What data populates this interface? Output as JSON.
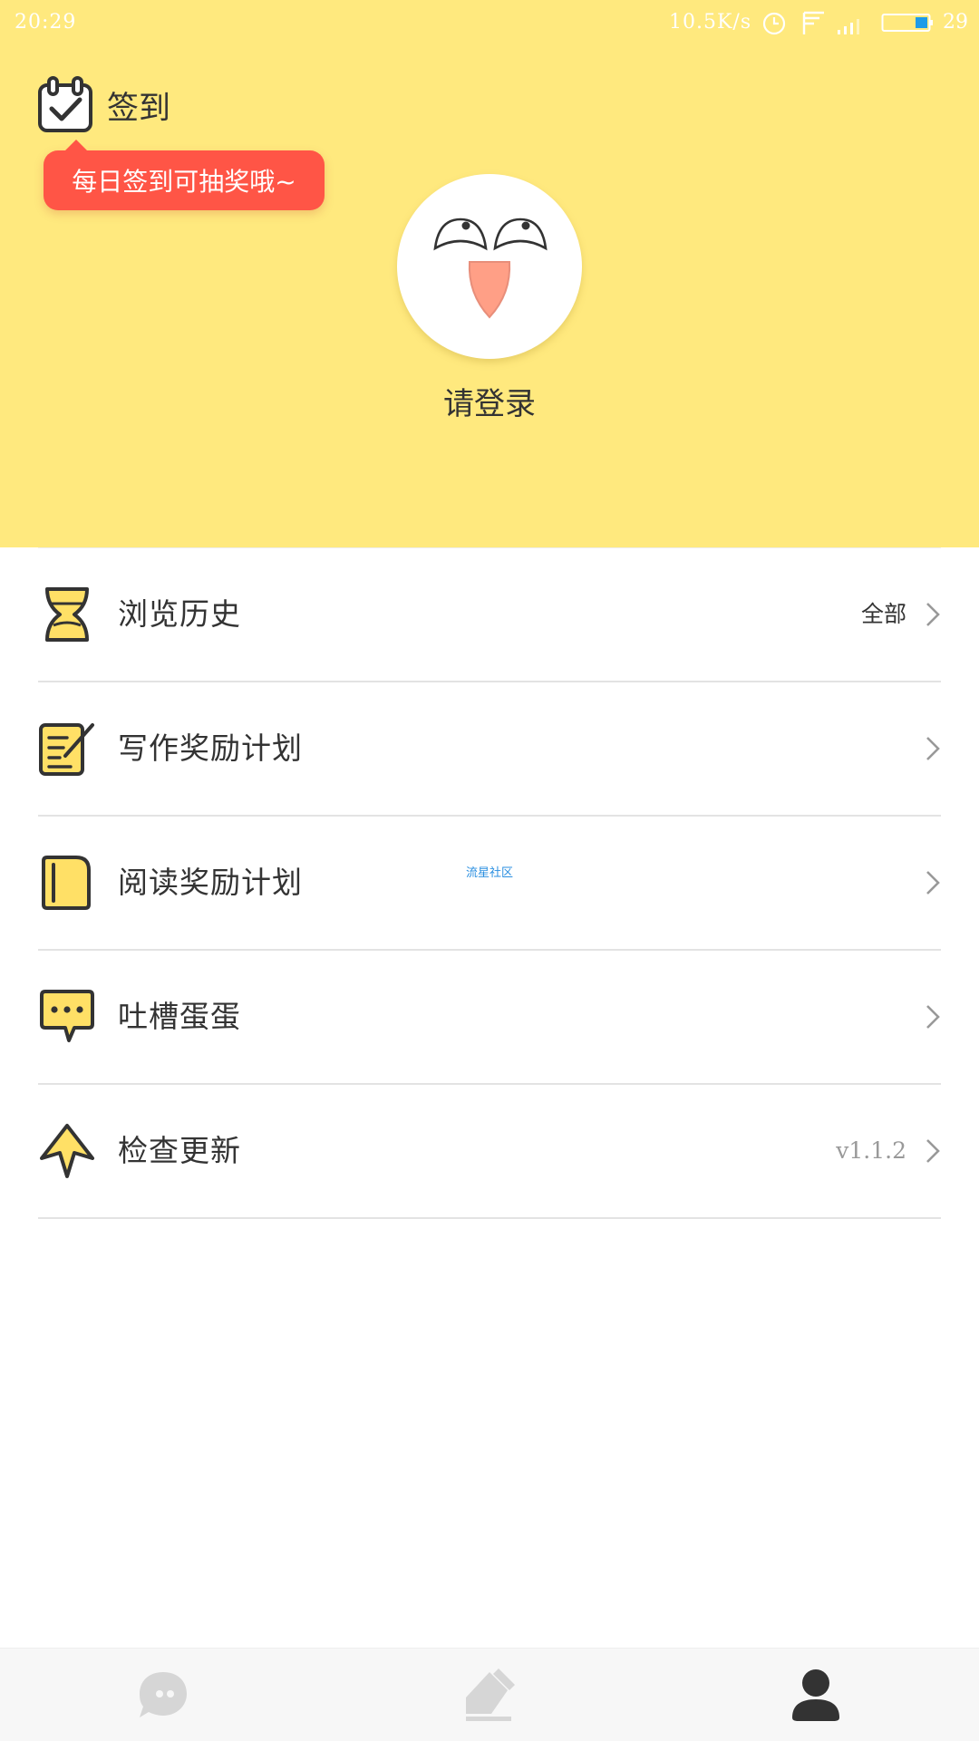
{
  "status_bar": {
    "time": "20:29",
    "network_speed": "10.5K/s",
    "battery_level": "29",
    "icons": [
      "alarm-clock-icon",
      "wifi-signal-icon",
      "cell-signal-icon",
      "battery-icon"
    ]
  },
  "header": {
    "background_color": "#FFE97E",
    "checkin": {
      "icon": "calendar-check-icon",
      "label": "签到"
    },
    "tooltip": {
      "text": "每日签到可抽奖哦~",
      "color": "#FF5546"
    },
    "avatar": {
      "icon": "smiling-face-avatar-icon"
    },
    "login_text": "请登录"
  },
  "menu": {
    "items": [
      {
        "icon": "hourglass-icon",
        "label": "浏览历史",
        "value": "全部"
      },
      {
        "icon": "notepad-pen-icon",
        "label": "写作奖励计划",
        "value": ""
      },
      {
        "icon": "book-icon",
        "label": "阅读奖励计划",
        "value": ""
      },
      {
        "icon": "speech-bubble-icon",
        "label": "吐槽蛋蛋",
        "value": ""
      },
      {
        "icon": "arrow-up-icon",
        "label": "检查更新",
        "value": "v1.1.2"
      }
    ]
  },
  "watermark": "流星社区",
  "bottom_nav": {
    "tabs": [
      {
        "icon": "chat-bubble-icon",
        "active": false
      },
      {
        "icon": "write-edit-icon",
        "active": false
      },
      {
        "icon": "profile-person-icon",
        "active": true
      }
    ],
    "active_color": "#333333",
    "inactive_color": "#D6D6D6"
  }
}
